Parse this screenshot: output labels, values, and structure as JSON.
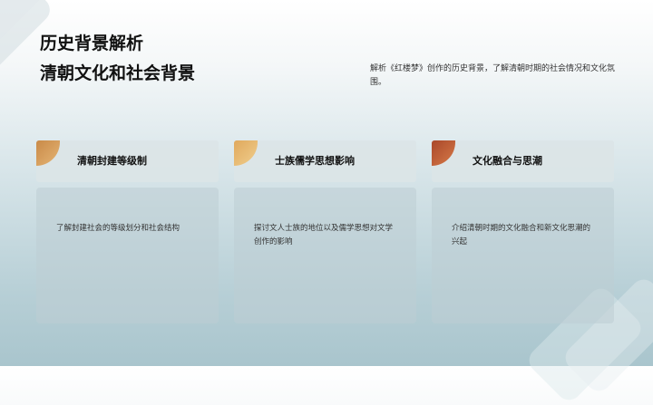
{
  "header": {
    "title": "历史背景解析",
    "subtitle": "清朝文化和社会背景",
    "intro": "解析《红楼梦》创作的历史背景，了解清朝时期的社会情况和文化氛围。"
  },
  "cards": [
    {
      "title": "清朝封建等级制",
      "description": "了解封建社会的等级划分和社会结构",
      "accent": "#d99a55"
    },
    {
      "title": "士族儒学思想影响",
      "description": "探讨文人士族的地位以及儒学思想对文学创作的影响",
      "accent": "#e7b872"
    },
    {
      "title": "文化融合与思潮",
      "description": "介绍清朝时期的文化融合和新文化思潮的兴起",
      "accent": "#c06036"
    }
  ],
  "colors": {
    "text": "#111111",
    "muted": "#333333"
  }
}
